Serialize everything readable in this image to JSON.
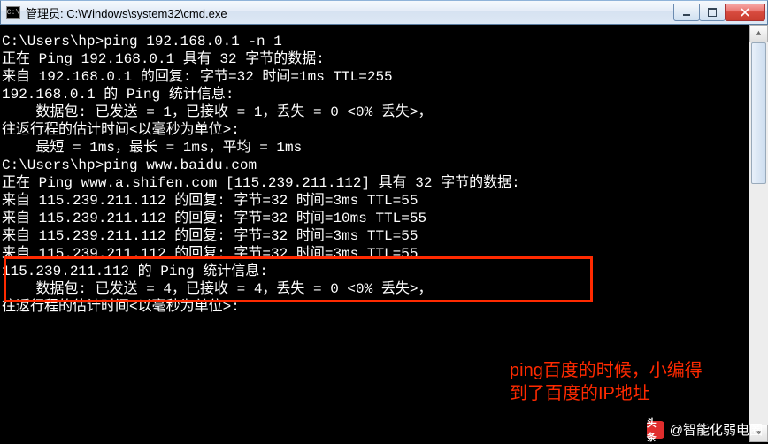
{
  "window": {
    "icon_label": "C:\\",
    "title": "管理员: C:\\Windows\\system32\\cmd.exe"
  },
  "terminal": {
    "lines": [
      "",
      "C:\\Users\\hp>ping 192.168.0.1 -n 1",
      "",
      "正在 Ping 192.168.0.1 具有 32 字节的数据:",
      "来自 192.168.0.1 的回复: 字节=32 时间=1ms TTL=255",
      "",
      "192.168.0.1 的 Ping 统计信息:",
      "    数据包: 已发送 = 1，已接收 = 1，丢失 = 0 <0% 丢失>，",
      "往返行程的估计时间<以毫秒为单位>:",
      "    最短 = 1ms，最长 = 1ms，平均 = 1ms",
      "",
      "C:\\Users\\hp>ping www.baidu.com",
      "",
      "正在 Ping www.a.shifen.com [115.239.211.112] 具有 32 字节的数据:",
      "来自 115.239.211.112 的回复: 字节=32 时间=3ms TTL=55",
      "来自 115.239.211.112 的回复: 字节=32 时间=10ms TTL=55",
      "来自 115.239.211.112 的回复: 字节=32 时间=3ms TTL=55",
      "来自 115.239.211.112 的回复: 字节=32 时间=3ms TTL=55",
      "",
      "115.239.211.112 的 Ping 统计信息:",
      "    数据包: 已发送 = 4，已接收 = 4，丢失 = 0 <0% 丢失>，",
      "往返行程的估计时间<以毫秒为单位>:"
    ]
  },
  "highlight": {
    "annotation_line1": "ping百度的时候，小编得",
    "annotation_line2": "到了百度的IP地址"
  },
  "watermark": {
    "logo_text": "头条",
    "handle": "@智能化弱电圈"
  }
}
